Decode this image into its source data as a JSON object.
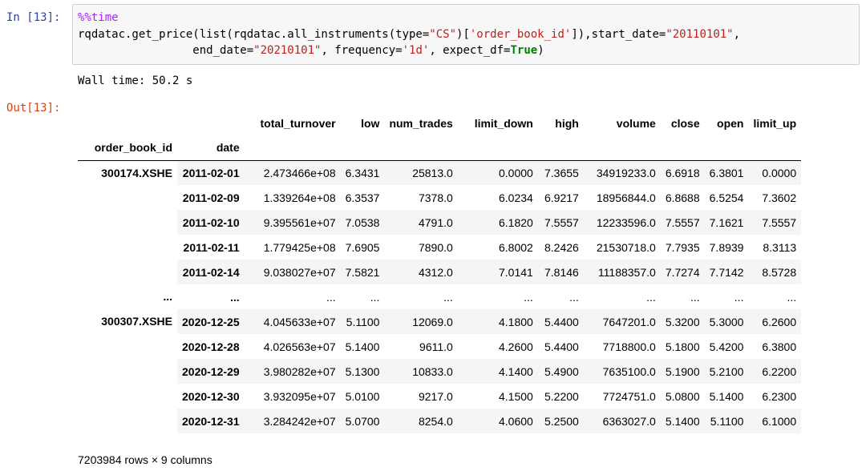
{
  "cell": {
    "in_prompt": "In [13]:",
    "out_prompt": "Out[13]:",
    "code": {
      "magic": "%%time",
      "line2_a": "rqdatac.get_price(list(rqdatac.all_instruments(type=",
      "line2_s1": "\"CS\"",
      "line2_b": ")[",
      "line2_s2": "'order_book_id'",
      "line2_c": "]),start_date=",
      "line2_s3": "\"20110101\"",
      "line2_d": ",",
      "line3_indent": "                 end_date=",
      "line3_s1": "\"20210101\"",
      "line3_b": ", frequency=",
      "line3_s2": "'1d'",
      "line3_c": ", expect_df=",
      "line3_kw": "True",
      "line3_d": ")"
    },
    "stdout": "Wall time: 50.2 s"
  },
  "dataframe": {
    "columns": [
      "total_turnover",
      "low",
      "num_trades",
      "limit_down",
      "high",
      "volume",
      "close",
      "open",
      "limit_up"
    ],
    "index_names": [
      "order_book_id",
      "date"
    ],
    "groups": [
      {
        "id": "300174.XSHE",
        "rows": [
          {
            "date": "2011-02-01",
            "values": [
              "2.473466e+08",
              "6.3431",
              "25813.0",
              "0.0000",
              "7.3655",
              "34919233.0",
              "6.6918",
              "6.3801",
              "0.0000"
            ]
          },
          {
            "date": "2011-02-09",
            "values": [
              "1.339264e+08",
              "6.3537",
              "7378.0",
              "6.0234",
              "6.9217",
              "18956844.0",
              "6.8688",
              "6.5254",
              "7.3602"
            ]
          },
          {
            "date": "2011-02-10",
            "values": [
              "9.395561e+07",
              "7.0538",
              "4791.0",
              "6.1820",
              "7.5557",
              "12233596.0",
              "7.5557",
              "7.1621",
              "7.5557"
            ]
          },
          {
            "date": "2011-02-11",
            "values": [
              "1.779425e+08",
              "7.6905",
              "7890.0",
              "6.8002",
              "8.2426",
              "21530718.0",
              "7.7935",
              "7.8939",
              "8.3113"
            ]
          },
          {
            "date": "2011-02-14",
            "values": [
              "9.038027e+07",
              "7.5821",
              "4312.0",
              "7.0141",
              "7.8146",
              "11188357.0",
              "7.7274",
              "7.7142",
              "8.5728"
            ]
          }
        ]
      },
      {
        "id": "...",
        "rows": [
          {
            "date": "...",
            "values": [
              "...",
              "...",
              "...",
              "...",
              "...",
              "...",
              "...",
              "...",
              "..."
            ]
          }
        ]
      },
      {
        "id": "300307.XSHE",
        "rows": [
          {
            "date": "2020-12-25",
            "values": [
              "4.045633e+07",
              "5.1100",
              "12069.0",
              "4.1800",
              "5.4400",
              "7647201.0",
              "5.3200",
              "5.3000",
              "6.2600"
            ]
          },
          {
            "date": "2020-12-28",
            "values": [
              "4.026563e+07",
              "5.1400",
              "9611.0",
              "4.2600",
              "5.4400",
              "7718800.0",
              "5.1800",
              "5.4200",
              "6.3800"
            ]
          },
          {
            "date": "2020-12-29",
            "values": [
              "3.980282e+07",
              "5.1300",
              "10833.0",
              "4.1400",
              "5.4900",
              "7635100.0",
              "5.1900",
              "5.2100",
              "6.2200"
            ]
          },
          {
            "date": "2020-12-30",
            "values": [
              "3.932095e+07",
              "5.0100",
              "9217.0",
              "4.1500",
              "5.2200",
              "7724751.0",
              "5.0800",
              "5.1400",
              "6.2300"
            ]
          },
          {
            "date": "2020-12-31",
            "values": [
              "3.284242e+07",
              "5.0700",
              "8254.0",
              "4.0600",
              "5.2500",
              "6363027.0",
              "5.1400",
              "5.1100",
              "6.1000"
            ]
          }
        ]
      }
    ],
    "shape_text": "7203984 rows × 9 columns"
  }
}
